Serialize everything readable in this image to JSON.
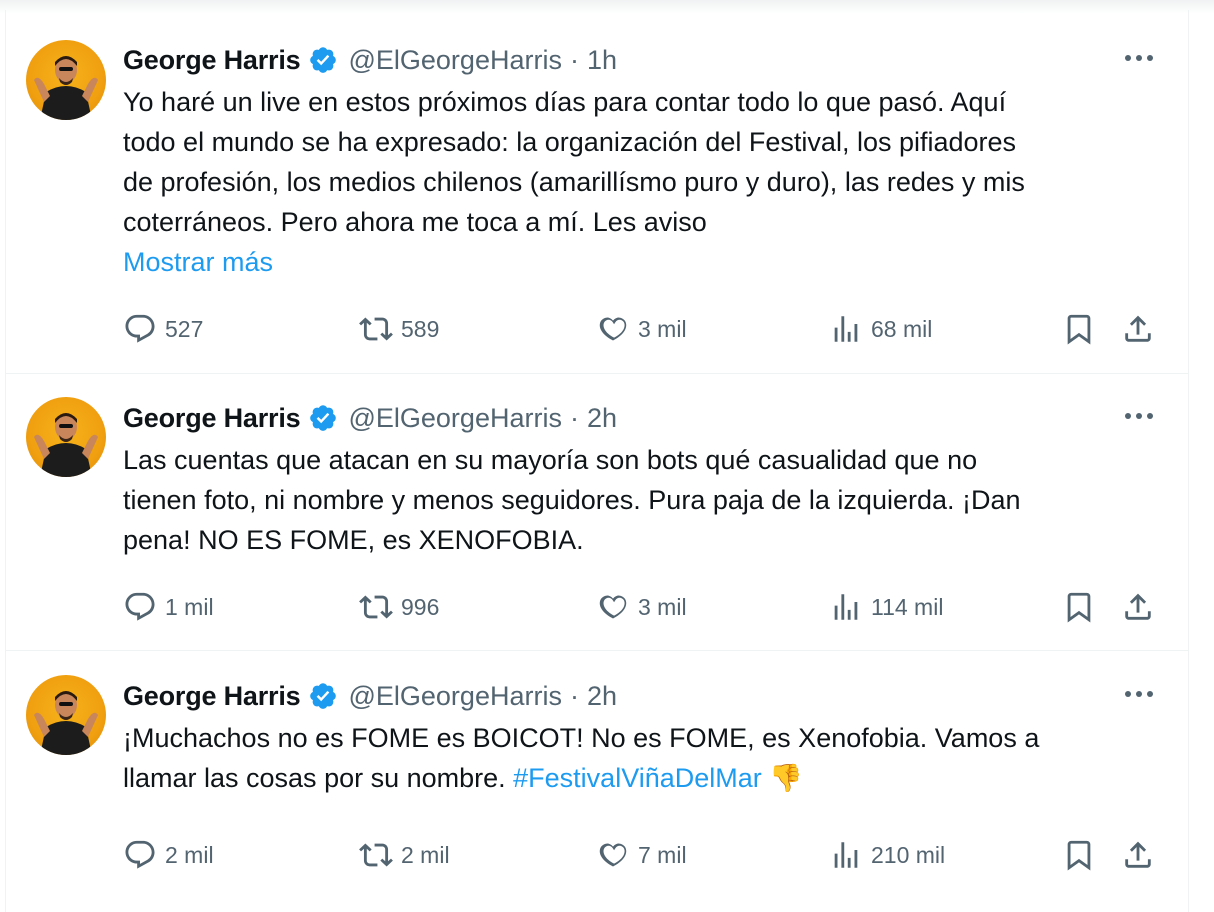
{
  "tweets": [
    {
      "name": "George Harris",
      "handle": "@ElGeorgeHarris",
      "separator": "·",
      "time": "1h",
      "lines": [
        "Yo haré un live en estos próximos días para contar todo lo que pasó. Aquí",
        "todo el mundo se ha expresado: la organización del Festival, los pifiadores",
        "de profesión, los medios chilenos (amarillísmo puro y duro), las redes y mis",
        "coterráneos. Pero ahora me toca a mí. Les aviso"
      ],
      "show_more": "Mostrar más",
      "replies": "527",
      "retweets": "589",
      "likes": "3 mil",
      "views": "68 mil"
    },
    {
      "name": "George Harris",
      "handle": "@ElGeorgeHarris",
      "separator": "·",
      "time": "2h",
      "lines": [
        "Las cuentas que atacan en su mayoría son bots qué casualidad que no",
        "tienen foto, ni nombre y menos seguidores. Pura paja de la izquierda. ¡Dan",
        "pena! NO ES FOME, es XENOFOBIA."
      ],
      "replies": "1 mil",
      "retweets": "996",
      "likes": "3 mil",
      "views": "114 mil"
    },
    {
      "name": "George Harris",
      "handle": "@ElGeorgeHarris",
      "separator": "·",
      "time": "2h",
      "line1": "¡Muchachos no es FOME es BOICOT! No es FOME, es Xenofobia. Vamos a",
      "line2_prefix": "llamar las cosas por su nombre. ",
      "hashtag": "#FestivalViñaDelMar",
      "emoji": "👎",
      "replies": "2 mil",
      "retweets": "2 mil",
      "likes": "7 mil",
      "views": "210 mil"
    }
  ],
  "colors": {
    "accent": "#1d9bf0",
    "muted": "#536471",
    "text": "#0f1419",
    "verified": "#1d9bf0",
    "avatar_bg": "#f0a010"
  },
  "icons": [
    "verified-badge-icon",
    "more-icon",
    "reply-icon",
    "retweet-icon",
    "like-icon",
    "views-icon",
    "bookmark-icon",
    "share-icon"
  ]
}
